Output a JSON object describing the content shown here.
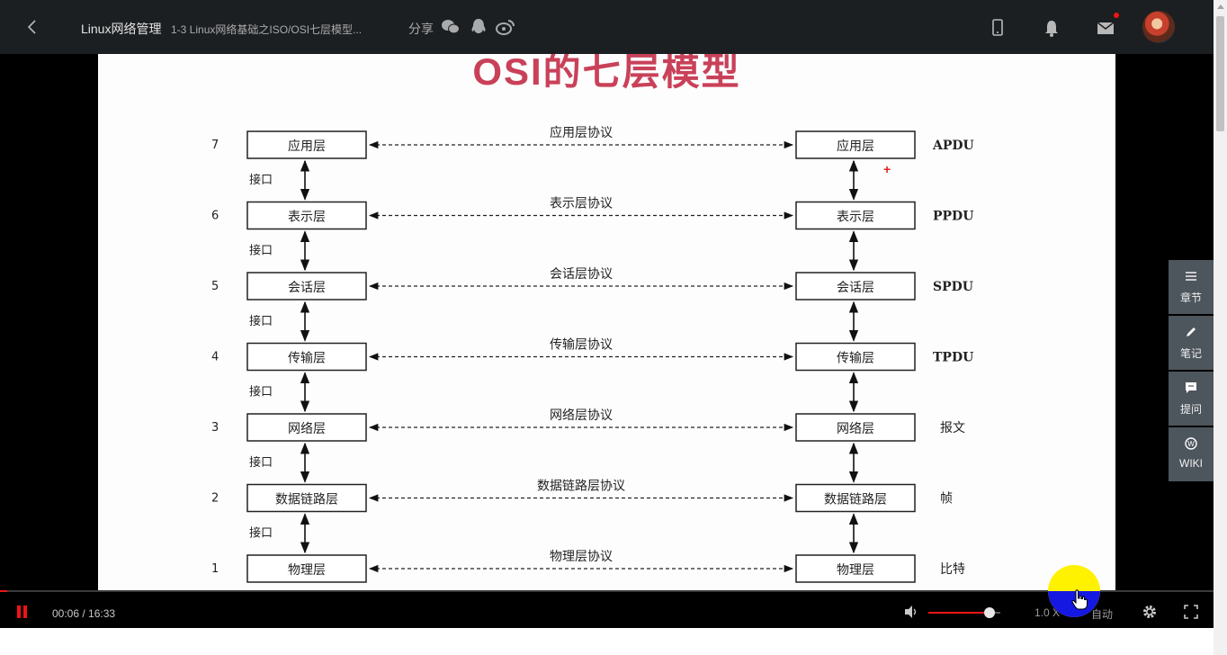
{
  "topbar": {
    "course_title": "Linux网络管理",
    "lesson_title": "1-3 Linux网络基础之ISO/OSI七层模型...",
    "share_label": "分享",
    "share_icons": [
      "wechat-icon",
      "qq-icon",
      "weibo-icon"
    ],
    "right_icons": [
      "mobile-icon",
      "bell-icon",
      "mail-icon"
    ],
    "mail_badge_color": "#f01414"
  },
  "slide": {
    "title": "OSI的七层模型",
    "layers": [
      {
        "num": "7",
        "name": "应用层",
        "protocol": "应用层协议",
        "pdu": "APDU"
      },
      {
        "num": "6",
        "name": "表示层",
        "protocol": "表示层协议",
        "pdu": "PPDU"
      },
      {
        "num": "5",
        "name": "会话层",
        "protocol": "会话层协议",
        "pdu": "SPDU"
      },
      {
        "num": "4",
        "name": "传输层",
        "protocol": "传输层协议",
        "pdu": "TPDU"
      },
      {
        "num": "3",
        "name": "网络层",
        "protocol": "网络层协议",
        "pdu": "报文"
      },
      {
        "num": "2",
        "name": "数据链路层",
        "protocol": "数据链路层协议",
        "pdu": "帧"
      },
      {
        "num": "1",
        "name": "物理层",
        "protocol": "物理层协议",
        "pdu": "比特"
      }
    ],
    "interface_label": "接口"
  },
  "sidepanel": [
    {
      "label": "章节",
      "icon": "list-icon"
    },
    {
      "label": "笔记",
      "icon": "pencil-icon"
    },
    {
      "label": "提问",
      "icon": "comment-icon"
    },
    {
      "label": "WIKI",
      "icon": "wiki-icon"
    }
  ],
  "controls": {
    "time": "00:06 / 16:33",
    "progress": 0.006,
    "volume": 0.85,
    "speed": "1.0 X",
    "quality": "自动"
  },
  "colors": {
    "accent": "#f01414",
    "topbar_bg": "#1c1f21",
    "slide_title": "#c94159",
    "side_panel_bg": "#4d555d"
  }
}
